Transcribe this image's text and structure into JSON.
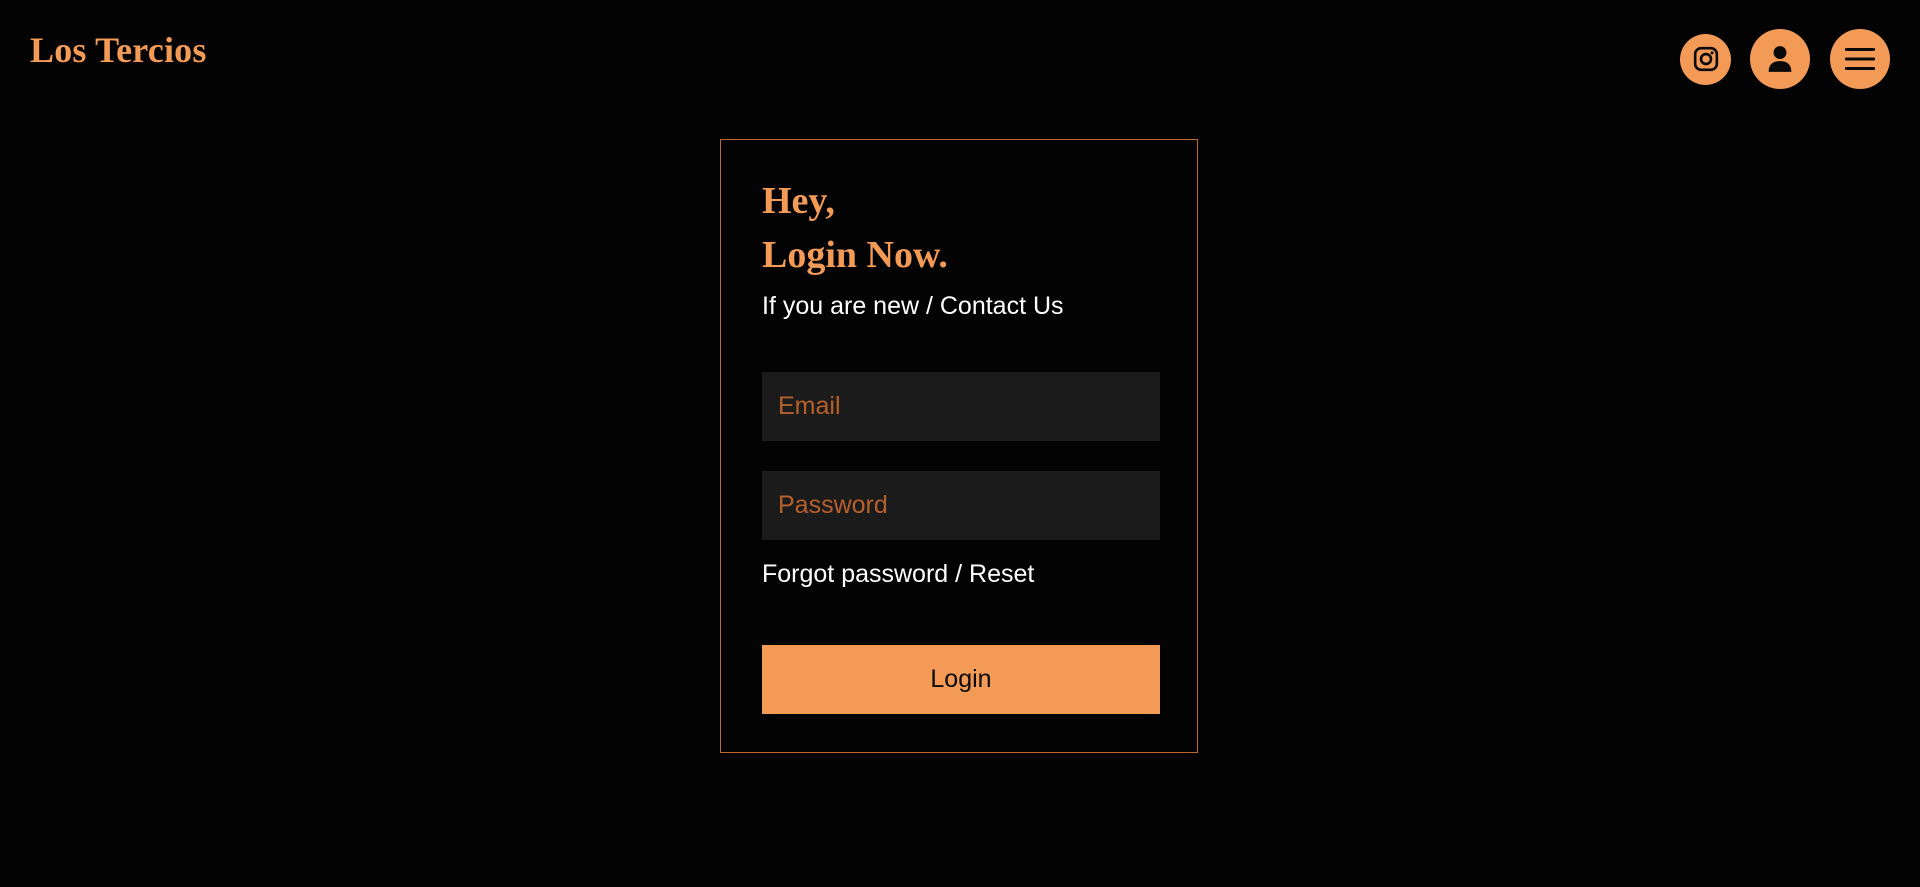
{
  "header": {
    "logo": "Los Tercios",
    "icons": [
      "instagram-icon",
      "user-icon",
      "menu-icon"
    ]
  },
  "login": {
    "heading_line1": "Hey,",
    "heading_line2": "Login Now.",
    "new_prefix": "If you are new / ",
    "contact_link": "Contact Us",
    "email_placeholder": "Email",
    "password_placeholder": "Password",
    "forgot_prefix": "Forgot password / ",
    "reset_link": "Reset",
    "button_label": "Login"
  },
  "colors": {
    "background": "#030303",
    "accent": "#f39a57",
    "card_border": "#c0672f",
    "input_bg": "#1b1b1b",
    "placeholder": "#b8602c"
  }
}
